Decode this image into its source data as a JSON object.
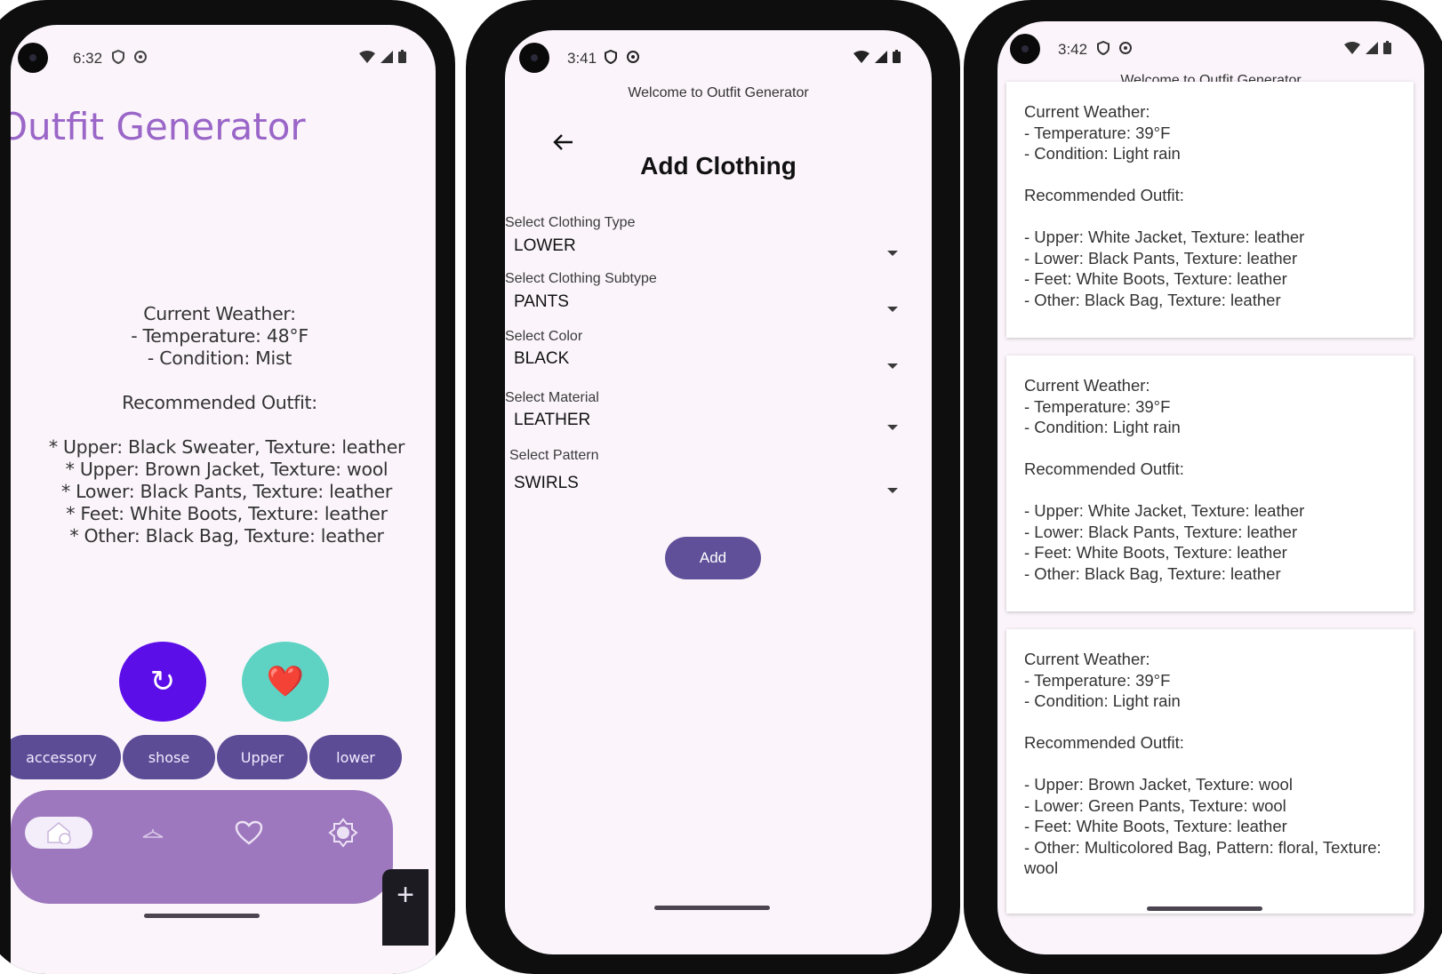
{
  "phone1": {
    "status": {
      "time": "6:32"
    },
    "title": "Outfit Generator",
    "weather_lines": [
      "Current Weather:",
      "- Temperature: 48°F",
      "- Condition: Mist"
    ],
    "recommended_heading": "Recommended Outfit:",
    "outfit_lines": [
      "* Upper: Black Sweater, Texture: leather",
      "* Upper: Brown Jacket, Texture: wool",
      "* Lower: Black Pants, Texture: leather",
      "* Feet: White Boots, Texture: leather",
      "* Other: Black Bag, Texture: leather"
    ],
    "refresh_glyph": "↻",
    "favorite_glyph": "❤️",
    "chips": [
      "accessory",
      "shose",
      "Upper",
      "lower"
    ],
    "fab_glyph": "+",
    "colors": {
      "title": "#9a66c8",
      "refresh_bg": "#5b0ee8",
      "favorite_bg": "#5ed3c3",
      "chip_bg": "#5c4c96",
      "navbar_bg": "#9e78be"
    }
  },
  "phone2": {
    "status": {
      "time": "3:41"
    },
    "welcome": "Welcome to Outfit Generator",
    "heading": "Add Clothing",
    "fields": [
      {
        "label": "Select Clothing Type",
        "value": "LOWER"
      },
      {
        "label": "Select Clothing Subtype",
        "value": "PANTS"
      },
      {
        "label": "Select Color",
        "value": "BLACK"
      },
      {
        "label": "Select Material",
        "value": "LEATHER"
      },
      {
        "label": "Select Pattern",
        "value": "SWIRLS"
      }
    ],
    "add_label": "Add",
    "colors": {
      "add_bg": "#5f5099"
    }
  },
  "phone3": {
    "status": {
      "time": "3:42"
    },
    "welcome": "Welcome to Outfit Generator",
    "cards": [
      {
        "lines": [
          "Current Weather:",
          "- Temperature: 39°F",
          "- Condition: Light rain",
          "",
          "Recommended Outfit:",
          "",
          "- Upper: White Jacket, Texture: leather",
          "- Lower: Black Pants, Texture: leather",
          "- Feet: White Boots, Texture: leather",
          "- Other: Black Bag, Texture: leather"
        ]
      },
      {
        "lines": [
          "Current Weather:",
          "- Temperature: 39°F",
          "- Condition: Light rain",
          "",
          "Recommended Outfit:",
          "",
          "- Upper: White Jacket, Texture: leather",
          "- Lower: Black Pants, Texture: leather",
          "- Feet: White Boots, Texture: leather",
          "- Other: Black Bag, Texture: leather"
        ]
      },
      {
        "lines": [
          "Current Weather:",
          "- Temperature: 39°F",
          "- Condition: Light rain",
          "",
          "Recommended Outfit:",
          "",
          "- Upper: Brown Jacket, Texture: wool",
          "- Lower: Green Pants, Texture: wool",
          "- Feet: White Boots, Texture: leather",
          "- Other: Multicolored Bag, Pattern: floral, Texture: wool"
        ]
      }
    ]
  }
}
